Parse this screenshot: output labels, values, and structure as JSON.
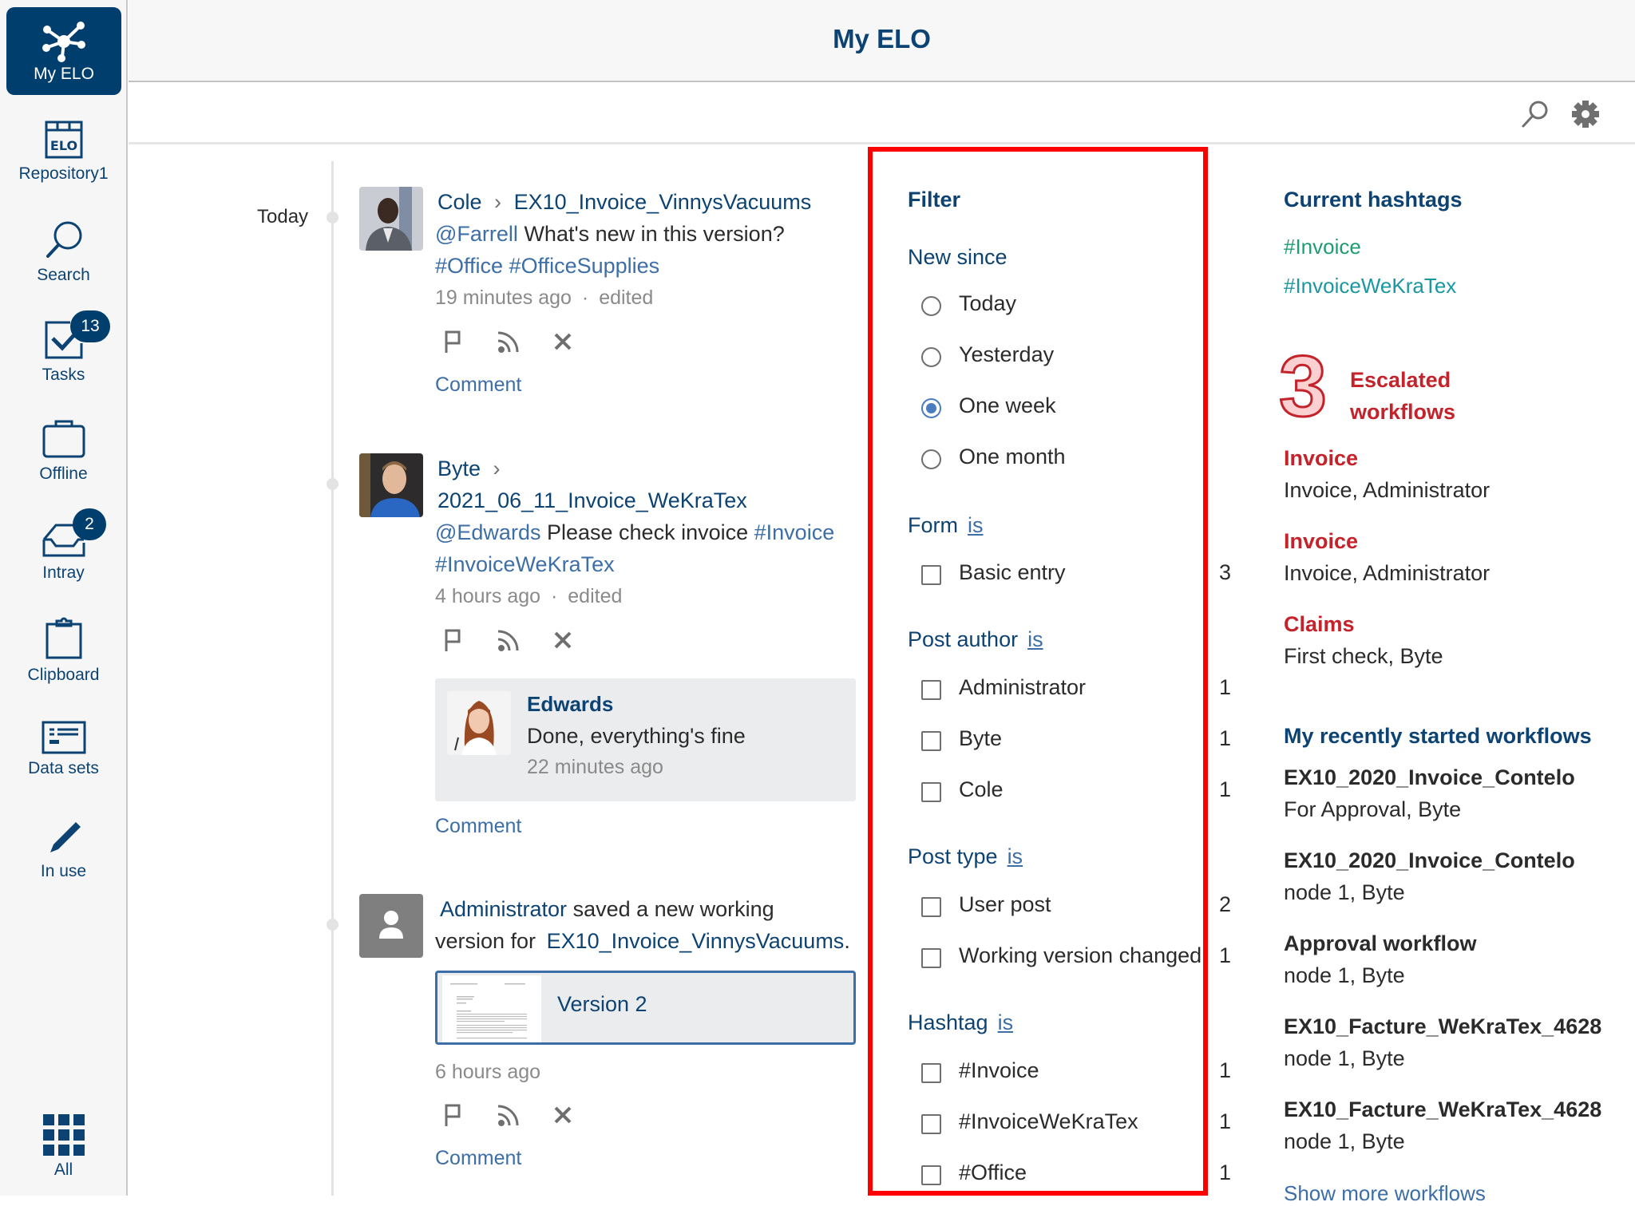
{
  "app": {
    "title": "My ELO"
  },
  "colors": {
    "brand": "#003e6e",
    "link": "#3d6ea6",
    "escalated": "#c4232b",
    "hashtag_1": "#1e9c74",
    "hashtag_2": "#1a97a1",
    "highlight_border": "#ff0000"
  },
  "sidebar": {
    "items": [
      {
        "label": "My ELO",
        "icon": "network-hub-icon",
        "active": true
      },
      {
        "label": "Repository1",
        "icon": "repository-icon"
      },
      {
        "label": "Search",
        "icon": "search-icon"
      },
      {
        "label": "Tasks",
        "icon": "tasks-checkbox-icon",
        "badge": "13"
      },
      {
        "label": "Offline",
        "icon": "briefcase-icon"
      },
      {
        "label": "Intray",
        "icon": "intray-icon",
        "badge": "2"
      },
      {
        "label": "Clipboard",
        "icon": "clipboard-icon"
      },
      {
        "label": "Data sets",
        "icon": "data-sets-icon"
      },
      {
        "label": "In use",
        "icon": "pencil-icon"
      },
      {
        "label": "All",
        "icon": "grid-icon"
      }
    ],
    "repository_icon_text": "ELO"
  },
  "toolbar": {
    "search_icon": "search-icon",
    "settings_icon": "gear-icon"
  },
  "feed": {
    "date_group": "Today",
    "posts": [
      {
        "author": "Cole",
        "separator": "›",
        "document": "EX10_Invoice_VinnysVacuums",
        "mention": "@Farrell",
        "text": "What's new in this version?",
        "hashtags": "#Office #OfficeSupplies",
        "time": "19 minutes ago",
        "dot": "·",
        "edited": "edited",
        "comment_label": "Comment"
      },
      {
        "author": "Byte",
        "separator": "›",
        "document": "2021_06_11_Invoice_WeKraTex",
        "mention": "@Edwards",
        "text": "Please check invoice",
        "hashtag_inline": "#Invoice",
        "hashtags": "#InvoiceWeKraTex",
        "time": "4 hours ago",
        "dot": "·",
        "edited": "edited",
        "reply": {
          "author": "Edwards",
          "text": "Done, everything's fine",
          "time": "22 minutes ago"
        },
        "comment_label": "Comment"
      },
      {
        "author": "Administrator",
        "text_1": "saved a new working",
        "text_2": "version for",
        "document": "EX10_Invoice_VinnysVacuums",
        "period": ".",
        "version_label": "Version 2",
        "time": "6 hours ago",
        "comment_label": "Comment"
      }
    ],
    "action_icons": [
      "flag-icon",
      "feed-subscribe-icon",
      "close-icon"
    ]
  },
  "filter": {
    "title": "Filter",
    "new_since": {
      "label": "New since",
      "options": [
        {
          "label": "Today",
          "selected": false
        },
        {
          "label": "Yesterday",
          "selected": false
        },
        {
          "label": "One week",
          "selected": true
        },
        {
          "label": "One month",
          "selected": false
        }
      ]
    },
    "groups": [
      {
        "label": "Form",
        "operator": "is",
        "options": [
          {
            "label": "Basic entry",
            "count": "3",
            "checked": false
          }
        ]
      },
      {
        "label": "Post author",
        "operator": "is",
        "options": [
          {
            "label": "Administrator",
            "count": "1",
            "checked": false
          },
          {
            "label": "Byte",
            "count": "1",
            "checked": false
          },
          {
            "label": "Cole",
            "count": "1",
            "checked": false
          }
        ]
      },
      {
        "label": "Post type",
        "operator": "is",
        "options": [
          {
            "label": "User post",
            "count": "2",
            "checked": false
          },
          {
            "label": "Working version changed",
            "count": "1",
            "checked": false
          }
        ]
      },
      {
        "label": "Hashtag",
        "operator": "is",
        "options": [
          {
            "label": "#Invoice",
            "count": "1",
            "checked": false
          },
          {
            "label": "#InvoiceWeKraTex",
            "count": "1",
            "checked": false
          },
          {
            "label": "#Office",
            "count": "1",
            "checked": false
          }
        ]
      }
    ]
  },
  "right": {
    "hashtags_title": "Current hashtags",
    "hashtags": [
      "#Invoice",
      "#InvoiceWeKraTex"
    ],
    "escalated": {
      "count": "3",
      "label_1": "Escalated",
      "label_2": "workflows",
      "items": [
        {
          "name": "Invoice",
          "detail": "Invoice, Administrator"
        },
        {
          "name": "Invoice",
          "detail": "Invoice, Administrator"
        },
        {
          "name": "Claims",
          "detail": "First check, Byte"
        }
      ]
    },
    "recent_title": "My recently started workflows",
    "recent": [
      {
        "name": "EX10_2020_Invoice_Contelo",
        "detail": "For Approval, Byte"
      },
      {
        "name": "EX10_2020_Invoice_Contelo",
        "detail": "node 1, Byte"
      },
      {
        "name": "Approval workflow",
        "detail": "node 1, Byte"
      },
      {
        "name": "EX10_Facture_WeKraTex_4628",
        "detail": "node 1, Byte"
      },
      {
        "name": "EX10_Facture_WeKraTex_4628",
        "detail": "node 1, Byte"
      }
    ],
    "show_more": "Show more workflows"
  }
}
